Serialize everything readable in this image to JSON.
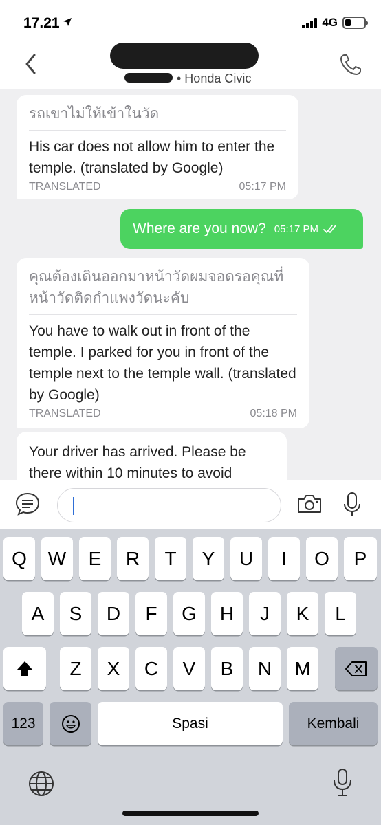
{
  "status_bar": {
    "time": "17.21",
    "network": "4G"
  },
  "header": {
    "subtitle": "• Honda Civic"
  },
  "messages": [
    {
      "direction": "in",
      "original": "รถเขาไม่ให้เข้าในวัด",
      "translation": "His car does not allow him to enter the temple. (translated by Google)",
      "label": "TRANSLATED",
      "time": "05:17 PM"
    },
    {
      "direction": "out",
      "text": "Where are you now?",
      "time": "05:17 PM"
    },
    {
      "direction": "in",
      "original": "คุณต้องเดินออกมาหน้าวัดผมจอดรอคุณที่หน้าวัดติดกำแพงวัดนะคับ",
      "translation": "You have to walk out in front of the temple. I parked for you in front of the temple next to the temple wall. (translated by Google)",
      "label": "TRANSLATED",
      "time": "05:18 PM"
    },
    {
      "direction": "in",
      "text": "Your driver has arrived. Please be there within 10 minutes to avoid"
    }
  ],
  "input": {
    "placeholder": ""
  },
  "keyboard": {
    "row1": [
      "Q",
      "W",
      "E",
      "R",
      "T",
      "Y",
      "U",
      "I",
      "O",
      "P"
    ],
    "row2": [
      "A",
      "S",
      "D",
      "F",
      "G",
      "H",
      "J",
      "K",
      "L"
    ],
    "row3": [
      "Z",
      "X",
      "C",
      "V",
      "B",
      "N",
      "M"
    ],
    "numbers_label": "123",
    "space_label": "Spasi",
    "return_label": "Kembali"
  },
  "icons": {
    "back": "chevron-left-icon",
    "call": "phone-icon",
    "quick_replies": "chat-bubble-icon",
    "camera": "camera-icon",
    "mic": "microphone-icon",
    "shift": "shift-icon",
    "delete": "backspace-icon",
    "emoji": "emoji-icon",
    "globe": "globe-icon",
    "dictation": "microphone-icon"
  },
  "colors": {
    "outgoing_bubble": "#4cd360",
    "caret": "#2f6fd6",
    "chat_bg": "#efeff1"
  }
}
